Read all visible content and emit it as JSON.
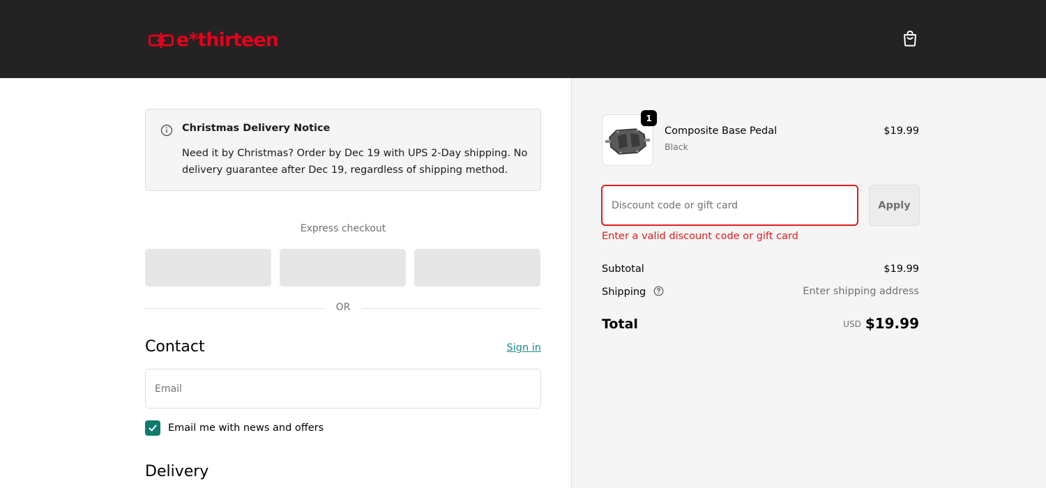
{
  "header": {
    "logo_text": "e*thirteen",
    "brand_color": "#e3001b",
    "cart_icon": "shopping-bag-icon"
  },
  "notice": {
    "icon": "info-icon",
    "title": "Christmas Delivery Notice",
    "body": "Need it by Christmas? Order by Dec 19 with UPS 2-Day shipping. No delivery guarantee after Dec 19, regardless of shipping method."
  },
  "express": {
    "label": "Express checkout",
    "divider": "OR"
  },
  "contact": {
    "title": "Contact",
    "sign_in": "Sign in",
    "email_placeholder": "Email",
    "email_value": "",
    "newsletter_checked": true,
    "newsletter_label": "Email me with news and offers"
  },
  "delivery": {
    "title": "Delivery"
  },
  "summary": {
    "item": {
      "name": "Composite Base Pedal",
      "variant": "Black",
      "price": "$19.99",
      "quantity": "1"
    },
    "discount": {
      "placeholder": "Discount code or gift card",
      "value": "",
      "apply_label": "Apply",
      "error": "Enter a valid discount code or gift card"
    },
    "subtotal_label": "Subtotal",
    "subtotal_value": "$19.99",
    "shipping_label": "Shipping",
    "shipping_value": "Enter shipping address",
    "total_label": "Total",
    "total_currency": "USD",
    "total_value": "$19.99"
  },
  "colors": {
    "header_bg": "#232323",
    "accent_teal": "#0f7a6e",
    "error_red": "#dd1d1d",
    "summary_bg": "#f5f5f5"
  }
}
